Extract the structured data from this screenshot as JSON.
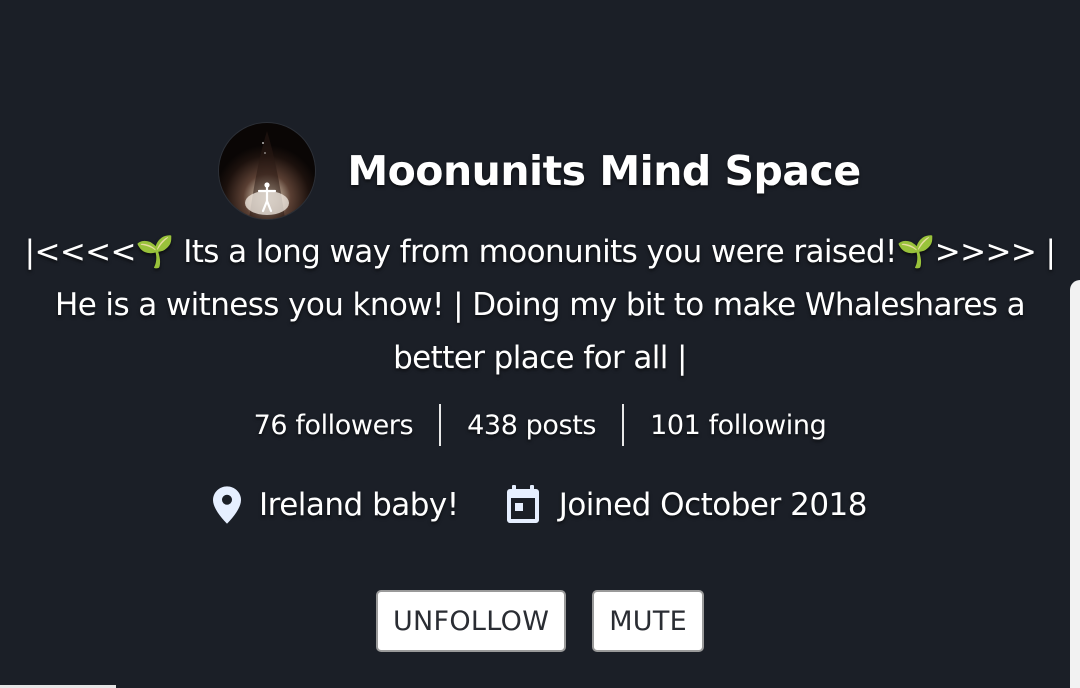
{
  "profile": {
    "display_name": "Moonunits Mind Space",
    "avatar": {
      "icon": "tunnel-figure-avatar",
      "alt": "profile picture"
    },
    "bio_lines": [
      "|<<<<🌱 Its a long way from moonunits you were raised!🌱>>>> |",
      "He is a witness you know! | Doing my bit to make Whaleshares a",
      "better place for all |"
    ],
    "stats": {
      "followers": "76 followers",
      "posts": "438 posts",
      "following": "101 following"
    },
    "location": {
      "icon": "location-pin-icon",
      "text": "Ireland baby!"
    },
    "joined": {
      "icon": "calendar-icon",
      "text": "Joined October 2018"
    }
  },
  "actions": {
    "unfollow_label": "UNFOLLOW",
    "mute_label": "MUTE"
  },
  "colors": {
    "background": "#1b1f27",
    "text": "#ffffff",
    "icon": "#e6efff",
    "button_bg": "#ffffff",
    "button_text": "#2a2d33"
  }
}
